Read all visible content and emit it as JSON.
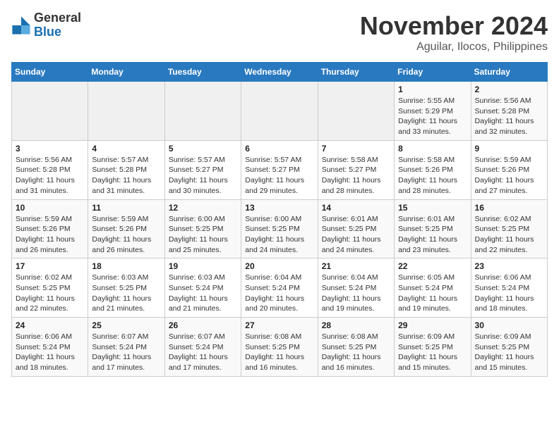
{
  "header": {
    "logo_general": "General",
    "logo_blue": "Blue",
    "month_title": "November 2024",
    "location": "Aguilar, Ilocos, Philippines"
  },
  "weekdays": [
    "Sunday",
    "Monday",
    "Tuesday",
    "Wednesday",
    "Thursday",
    "Friday",
    "Saturday"
  ],
  "weeks": [
    [
      {
        "day": "",
        "info": ""
      },
      {
        "day": "",
        "info": ""
      },
      {
        "day": "",
        "info": ""
      },
      {
        "day": "",
        "info": ""
      },
      {
        "day": "",
        "info": ""
      },
      {
        "day": "1",
        "info": "Sunrise: 5:55 AM\nSunset: 5:29 PM\nDaylight: 11 hours and 33 minutes."
      },
      {
        "day": "2",
        "info": "Sunrise: 5:56 AM\nSunset: 5:28 PM\nDaylight: 11 hours and 32 minutes."
      }
    ],
    [
      {
        "day": "3",
        "info": "Sunrise: 5:56 AM\nSunset: 5:28 PM\nDaylight: 11 hours and 31 minutes."
      },
      {
        "day": "4",
        "info": "Sunrise: 5:57 AM\nSunset: 5:28 PM\nDaylight: 11 hours and 31 minutes."
      },
      {
        "day": "5",
        "info": "Sunrise: 5:57 AM\nSunset: 5:27 PM\nDaylight: 11 hours and 30 minutes."
      },
      {
        "day": "6",
        "info": "Sunrise: 5:57 AM\nSunset: 5:27 PM\nDaylight: 11 hours and 29 minutes."
      },
      {
        "day": "7",
        "info": "Sunrise: 5:58 AM\nSunset: 5:27 PM\nDaylight: 11 hours and 28 minutes."
      },
      {
        "day": "8",
        "info": "Sunrise: 5:58 AM\nSunset: 5:26 PM\nDaylight: 11 hours and 28 minutes."
      },
      {
        "day": "9",
        "info": "Sunrise: 5:59 AM\nSunset: 5:26 PM\nDaylight: 11 hours and 27 minutes."
      }
    ],
    [
      {
        "day": "10",
        "info": "Sunrise: 5:59 AM\nSunset: 5:26 PM\nDaylight: 11 hours and 26 minutes."
      },
      {
        "day": "11",
        "info": "Sunrise: 5:59 AM\nSunset: 5:26 PM\nDaylight: 11 hours and 26 minutes."
      },
      {
        "day": "12",
        "info": "Sunrise: 6:00 AM\nSunset: 5:25 PM\nDaylight: 11 hours and 25 minutes."
      },
      {
        "day": "13",
        "info": "Sunrise: 6:00 AM\nSunset: 5:25 PM\nDaylight: 11 hours and 24 minutes."
      },
      {
        "day": "14",
        "info": "Sunrise: 6:01 AM\nSunset: 5:25 PM\nDaylight: 11 hours and 24 minutes."
      },
      {
        "day": "15",
        "info": "Sunrise: 6:01 AM\nSunset: 5:25 PM\nDaylight: 11 hours and 23 minutes."
      },
      {
        "day": "16",
        "info": "Sunrise: 6:02 AM\nSunset: 5:25 PM\nDaylight: 11 hours and 22 minutes."
      }
    ],
    [
      {
        "day": "17",
        "info": "Sunrise: 6:02 AM\nSunset: 5:25 PM\nDaylight: 11 hours and 22 minutes."
      },
      {
        "day": "18",
        "info": "Sunrise: 6:03 AM\nSunset: 5:25 PM\nDaylight: 11 hours and 21 minutes."
      },
      {
        "day": "19",
        "info": "Sunrise: 6:03 AM\nSunset: 5:24 PM\nDaylight: 11 hours and 21 minutes."
      },
      {
        "day": "20",
        "info": "Sunrise: 6:04 AM\nSunset: 5:24 PM\nDaylight: 11 hours and 20 minutes."
      },
      {
        "day": "21",
        "info": "Sunrise: 6:04 AM\nSunset: 5:24 PM\nDaylight: 11 hours and 19 minutes."
      },
      {
        "day": "22",
        "info": "Sunrise: 6:05 AM\nSunset: 5:24 PM\nDaylight: 11 hours and 19 minutes."
      },
      {
        "day": "23",
        "info": "Sunrise: 6:06 AM\nSunset: 5:24 PM\nDaylight: 11 hours and 18 minutes."
      }
    ],
    [
      {
        "day": "24",
        "info": "Sunrise: 6:06 AM\nSunset: 5:24 PM\nDaylight: 11 hours and 18 minutes."
      },
      {
        "day": "25",
        "info": "Sunrise: 6:07 AM\nSunset: 5:24 PM\nDaylight: 11 hours and 17 minutes."
      },
      {
        "day": "26",
        "info": "Sunrise: 6:07 AM\nSunset: 5:24 PM\nDaylight: 11 hours and 17 minutes."
      },
      {
        "day": "27",
        "info": "Sunrise: 6:08 AM\nSunset: 5:25 PM\nDaylight: 11 hours and 16 minutes."
      },
      {
        "day": "28",
        "info": "Sunrise: 6:08 AM\nSunset: 5:25 PM\nDaylight: 11 hours and 16 minutes."
      },
      {
        "day": "29",
        "info": "Sunrise: 6:09 AM\nSunset: 5:25 PM\nDaylight: 11 hours and 15 minutes."
      },
      {
        "day": "30",
        "info": "Sunrise: 6:09 AM\nSunset: 5:25 PM\nDaylight: 11 hours and 15 minutes."
      }
    ]
  ]
}
